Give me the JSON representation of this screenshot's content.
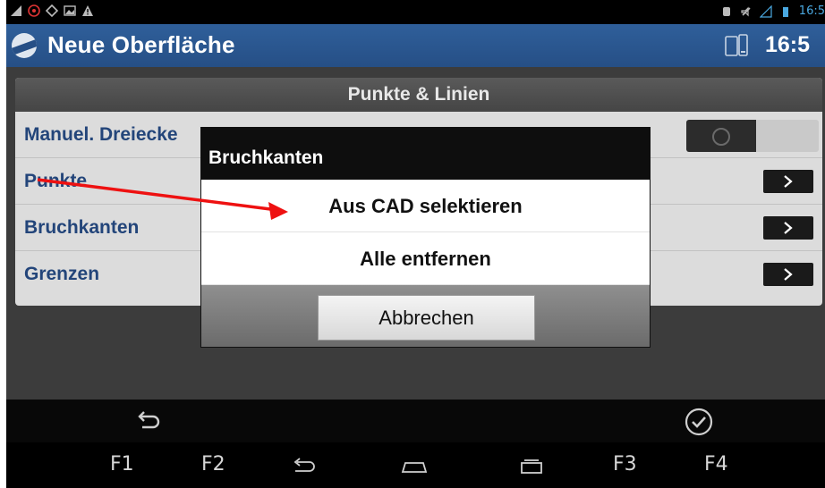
{
  "status_bar": {
    "left_icons": [
      "signal-icon",
      "notification-icon",
      "sync-icon",
      "image-icon",
      "warning-icon"
    ],
    "time": "16:5"
  },
  "action_bar": {
    "title": "Neue Oberfläche",
    "clock": "16:5"
  },
  "panel": {
    "header": "Punkte & Linien",
    "rows": [
      {
        "label": "Manuel. Dreiecke",
        "control": "toggle",
        "state": "off"
      },
      {
        "label": "Punkte",
        "control": "chevron"
      },
      {
        "label": "Bruchkanten",
        "control": "chevron"
      },
      {
        "label": "Grenzen",
        "control": "chevron"
      }
    ]
  },
  "dialog": {
    "title": "Bruchkanten",
    "options": [
      "Aus CAD selektieren",
      "Alle entfernen"
    ],
    "cancel_label": "Abbrechen"
  },
  "nav_bar": {
    "f1": "F1",
    "f2": "F2",
    "f3": "F3",
    "f4": "F4"
  },
  "colors": {
    "accent": "#264f86",
    "label": "#23457a",
    "annotation_arrow": "#ee1111"
  }
}
